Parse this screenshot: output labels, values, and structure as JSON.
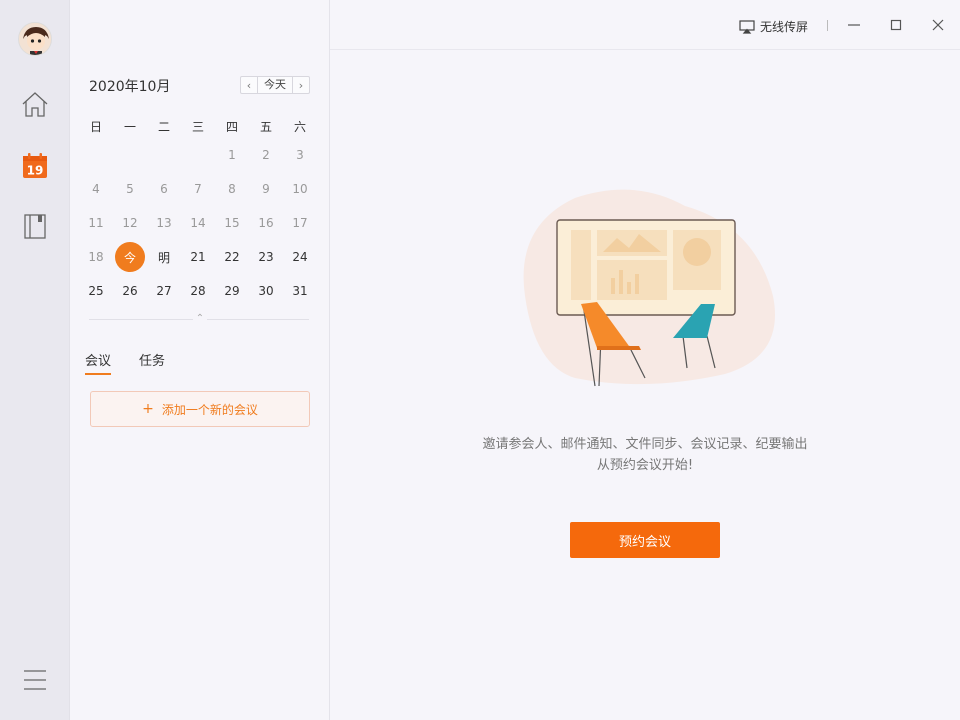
{
  "rail": {
    "items": [
      {
        "name": "home",
        "icon": "home-icon"
      },
      {
        "name": "calendar",
        "icon": "calendar-icon",
        "badge": "19"
      },
      {
        "name": "notes",
        "icon": "notebook-icon"
      }
    ],
    "menu_icon": "hamburger-menu-icon"
  },
  "calendar": {
    "month_title": "2020年10月",
    "today_label": "今天",
    "weekdays": [
      "日",
      "一",
      "二",
      "三",
      "四",
      "五",
      "六"
    ],
    "weeks": [
      [
        "",
        "",
        "",
        "",
        "1",
        "2",
        "3"
      ],
      [
        "4",
        "5",
        "6",
        "7",
        "8",
        "9",
        "10"
      ],
      [
        "11",
        "12",
        "13",
        "14",
        "15",
        "16",
        "17"
      ],
      [
        "18",
        "今",
        "明",
        "21",
        "22",
        "23",
        "24"
      ],
      [
        "25",
        "26",
        "27",
        "28",
        "29",
        "30",
        "31"
      ]
    ]
  },
  "tabs": [
    {
      "label": "会议",
      "active": true
    },
    {
      "label": "任务",
      "active": false
    }
  ],
  "add_meeting_label": "添加一个新的会议",
  "titlebar": {
    "cast_label": "无线传屏"
  },
  "empty_state": {
    "line1": "邀请参会人、邮件通知、文件同步、会议记录、纪要输出",
    "line2": "从预约会议开始!",
    "button_label": "预约会议"
  },
  "colors": {
    "accent": "#f07c1e",
    "button": "#f5690c",
    "chair_orange": "#f58a2a",
    "chair_teal": "#2aa3b2"
  }
}
